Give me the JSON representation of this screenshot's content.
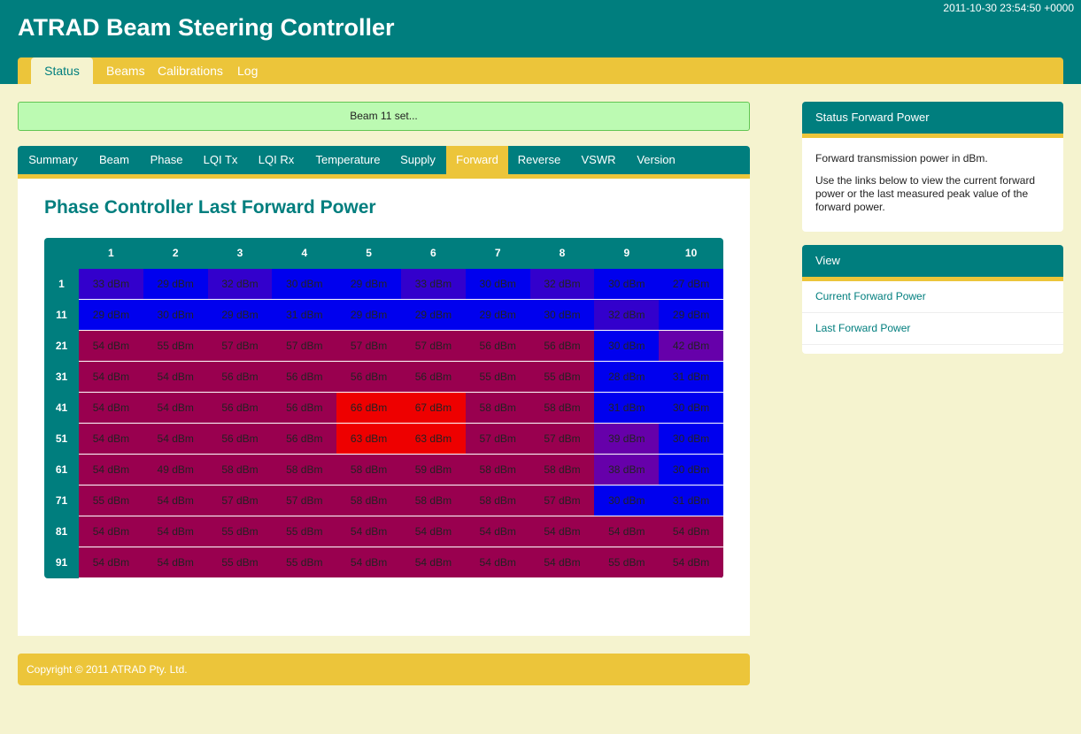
{
  "header": {
    "timestamp": "2011-10-30 23:54:50 +0000",
    "title": "ATRAD Beam Steering Controller"
  },
  "topnav": {
    "items": [
      "Status",
      "Beams",
      "Calibrations",
      "Log"
    ],
    "active": "Status"
  },
  "notice": {
    "text": "Beam 11 set..."
  },
  "subtabs": {
    "items": [
      "Summary",
      "Beam",
      "Phase",
      "LQI Tx",
      "LQI Rx",
      "Temperature",
      "Supply",
      "Forward",
      "Reverse",
      "VSWR",
      "Version"
    ],
    "active": "Forward"
  },
  "main": {
    "title": "Phase Controller Last Forward Power"
  },
  "table": {
    "column_headers": [
      "1",
      "2",
      "3",
      "4",
      "5",
      "6",
      "7",
      "8",
      "9",
      "10"
    ],
    "row_headers": [
      "1",
      "11",
      "21",
      "31",
      "41",
      "51",
      "61",
      "71",
      "81",
      "91"
    ],
    "unit": "dBm",
    "values": [
      [
        33,
        29,
        32,
        30,
        29,
        33,
        30,
        32,
        30,
        27
      ],
      [
        29,
        30,
        29,
        31,
        29,
        29,
        29,
        30,
        32,
        29
      ],
      [
        54,
        55,
        57,
        57,
        57,
        57,
        56,
        56,
        30,
        42
      ],
      [
        54,
        54,
        56,
        56,
        56,
        56,
        55,
        55,
        28,
        31
      ],
      [
        54,
        54,
        56,
        56,
        66,
        67,
        58,
        58,
        31,
        30
      ],
      [
        54,
        54,
        56,
        56,
        63,
        63,
        57,
        57,
        39,
        30
      ],
      [
        54,
        49,
        58,
        58,
        58,
        59,
        58,
        58,
        38,
        30
      ],
      [
        55,
        54,
        57,
        57,
        58,
        58,
        58,
        57,
        30,
        31
      ],
      [
        54,
        54,
        55,
        55,
        54,
        54,
        54,
        54,
        54,
        54
      ],
      [
        54,
        54,
        55,
        55,
        54,
        54,
        54,
        54,
        55,
        54
      ]
    ],
    "colors": {
      "low": "#0000ee",
      "low_mid": "#3300cc",
      "mid": "#6600aa",
      "high": "#99004f",
      "peak": "#ee0000"
    }
  },
  "footer": {
    "copyright": "Copyright © 2011 ATRAD Pty. Ltd."
  },
  "sidebar": {
    "status_box": {
      "title": "Status Forward Power",
      "paragraphs": [
        "Forward transmission power in dBm.",
        "Use the links below to view the current forward power or the last measured peak value of the forward power."
      ]
    },
    "view_box": {
      "title": "View",
      "links": [
        "Current Forward Power",
        "Last Forward Power"
      ]
    }
  }
}
